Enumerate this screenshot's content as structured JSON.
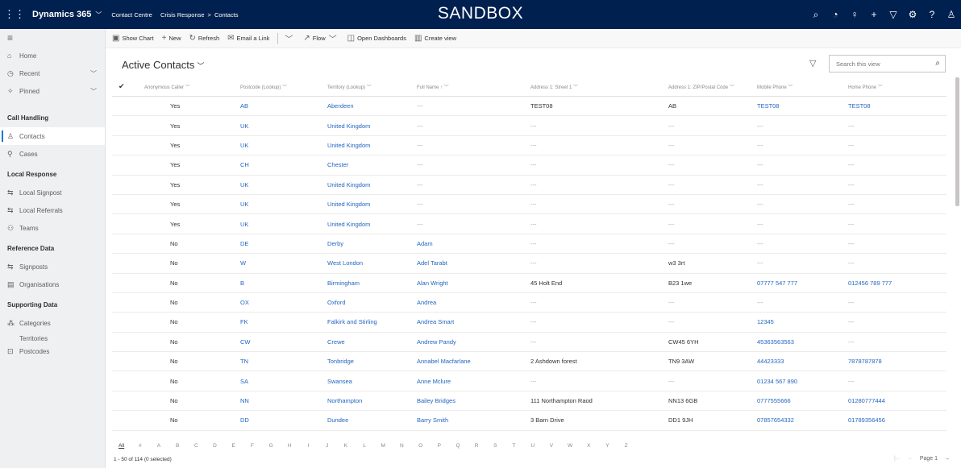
{
  "topbar": {
    "app_name": "Dynamics 365",
    "crumb_1": "Contact Centre",
    "crumb_2": "Crisis Response",
    "crumb_sep": ">",
    "crumb_3": "Contacts",
    "environment_label": "SANDBOX",
    "icons": [
      "search-icon",
      "task-icon",
      "lightbulb-icon",
      "plus-icon",
      "filter-icon",
      "settings-icon",
      "help-icon",
      "user-icon"
    ]
  },
  "sidebar": {
    "home": "Home",
    "recent": "Recent",
    "pinned": "Pinned",
    "sections": [
      {
        "title": "Call Handling",
        "items": [
          {
            "label": "Contacts",
            "icon": "person-icon"
          },
          {
            "label": "Cases",
            "icon": "wrench-icon"
          }
        ]
      },
      {
        "title": "Local Response",
        "items": [
          {
            "label": "Local Signpost",
            "icon": "arrows-icon"
          },
          {
            "label": "Local Referrals",
            "icon": "arrows-icon"
          },
          {
            "label": "Teams",
            "icon": "team-icon"
          }
        ]
      },
      {
        "title": "Reference Data",
        "items": [
          {
            "label": "Signposts",
            "icon": "arrows-icon"
          },
          {
            "label": "Organisations",
            "icon": "building-icon"
          }
        ]
      },
      {
        "title": "Supporting Data",
        "items": [
          {
            "label": "Categories",
            "icon": "categories-icon"
          },
          {
            "label": "Territories",
            "icon": ""
          },
          {
            "label": "Postcodes",
            "icon": "postcode-icon"
          }
        ]
      }
    ]
  },
  "commandbar": {
    "show_chart": "Show Chart",
    "new": "New",
    "refresh": "Refresh",
    "email_link": "Email a Link",
    "flow": "Flow",
    "open_dashboards": "Open Dashboards",
    "create_view": "Create view"
  },
  "view": {
    "title": "Active Contacts",
    "search_placeholder": "Search this view"
  },
  "grid": {
    "columns": [
      "Anonymous Caller",
      "Postcode (Lookup)",
      "Territory (Lookup)",
      "Full Name ↑",
      "Address 1: Street 1",
      "Address 1: ZIP/Postal Code",
      "Mobile Phone",
      "Home Phone"
    ],
    "rows": [
      [
        "Yes",
        "AB",
        "Aberdeen",
        "---",
        "TEST08",
        "AB",
        "TEST08",
        "TEST08"
      ],
      [
        "Yes",
        "UK",
        "United Kingdom",
        "---",
        "---",
        "---",
        "---",
        "---"
      ],
      [
        "Yes",
        "UK",
        "United Kingdom",
        "---",
        "---",
        "---",
        "---",
        "---"
      ],
      [
        "Yes",
        "CH",
        "Chester",
        "---",
        "---",
        "---",
        "---",
        "---"
      ],
      [
        "Yes",
        "UK",
        "United Kingdom",
        "---",
        "---",
        "---",
        "---",
        "---"
      ],
      [
        "Yes",
        "UK",
        "United Kingdom",
        "---",
        "---",
        "---",
        "---",
        "---"
      ],
      [
        "Yes",
        "UK",
        "United Kingdom",
        "---",
        "---",
        "---",
        "---",
        "---"
      ],
      [
        "No",
        "DE",
        "Derby",
        "Adam",
        "---",
        "---",
        "---",
        "---"
      ],
      [
        "No",
        "W",
        "West London",
        "Adel Tarabt",
        "---",
        "w3 3rt",
        "---",
        "---"
      ],
      [
        "No",
        "B",
        "Birmingham",
        "Alan Wright",
        "45 Holt End",
        "B23 1we",
        "07777 547 777",
        "012456 789 777"
      ],
      [
        "No",
        "OX",
        "Oxford",
        "Andrea",
        "---",
        "---",
        "---",
        "---"
      ],
      [
        "No",
        "FK",
        "Falkirk and Stirling",
        "Andrea Smart",
        "---",
        "---",
        "12345",
        "---"
      ],
      [
        "No",
        "CW",
        "Crewe",
        "Andrew Pandy",
        "---",
        "CW45 6YH",
        "45363563563",
        "---"
      ],
      [
        "No",
        "TN",
        "Tonbridge",
        "Annabel Macfarlane",
        "2 Ashdown forest",
        "TN9 3AW",
        "44423333",
        "7878787878"
      ],
      [
        "No",
        "SA",
        "Swansea",
        "Anne Mclure",
        "---",
        "---",
        "01234 567 890",
        "---"
      ],
      [
        "No",
        "NN",
        "Northampton",
        "Bailey Bridges",
        "111 Northampton Raod",
        "NN13 6GB",
        "0777555666",
        "01280777444"
      ],
      [
        "No",
        "DD",
        "Dundee",
        "Barry Smith",
        "3 Barn Drive",
        "DD1 9JH",
        "07857654332",
        "01789356456"
      ]
    ]
  },
  "alphabet": [
    "All",
    "#",
    "A",
    "B",
    "C",
    "D",
    "E",
    "F",
    "G",
    "H",
    "I",
    "J",
    "K",
    "L",
    "M",
    "N",
    "O",
    "P",
    "Q",
    "R",
    "S",
    "T",
    "U",
    "V",
    "W",
    "X",
    "Y",
    "Z"
  ],
  "footer": {
    "record_count": "1 - 50 of 114 (0 selected)",
    "page_label": "Page 1"
  }
}
